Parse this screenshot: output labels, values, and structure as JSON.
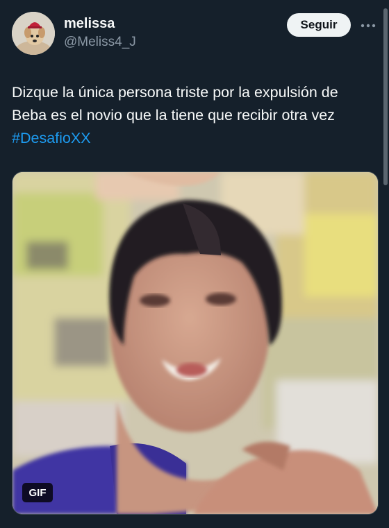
{
  "user": {
    "name": "melissa",
    "handle": "@Meliss4_J"
  },
  "follow_label": "Seguir",
  "tweet": {
    "text": "Dizque la única persona triste por la expulsión de Beba es el novio que la tiene que recibir otra vez ",
    "hashtag": "#DesafioXX"
  },
  "media": {
    "badge": "GIF"
  },
  "icons": {
    "more": "more-horizontal-icon"
  },
  "colors": {
    "background": "#15202b",
    "text": "#f7f9f9",
    "secondary": "#8b98a5",
    "link": "#1d9bf0",
    "button_bg": "#eff3f4"
  }
}
